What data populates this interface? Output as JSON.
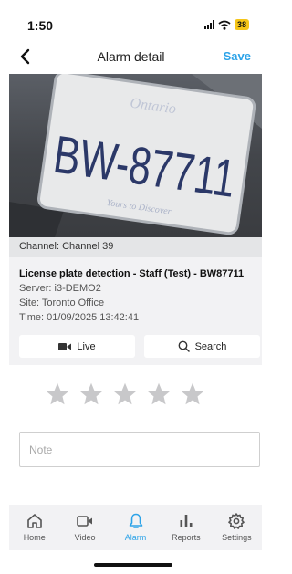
{
  "status_bar": {
    "time": "1:50",
    "battery": "38"
  },
  "header": {
    "title": "Alarm detail",
    "save_label": "Save"
  },
  "photo": {
    "plate_text": "BW-87711",
    "plate_region": "Ontario",
    "plate_tagline": "Yours to Discover"
  },
  "channel": {
    "label": "Channel: Channel 39"
  },
  "alarm": {
    "title": "License plate detection - Staff (Test) - BW87711",
    "server": "Server: i3-DEMO2",
    "site": "Site: Toronto Office",
    "time": "Time: 01/09/2025 13:42:41"
  },
  "actions": {
    "live_label": "Live",
    "search_label": "Search"
  },
  "rating": {
    "value": 0,
    "max": 5
  },
  "note": {
    "placeholder": "Note",
    "value": ""
  },
  "tabs": [
    {
      "label": "Home",
      "icon": "home-icon"
    },
    {
      "label": "Video",
      "icon": "video-camera-icon"
    },
    {
      "label": "Alarm",
      "icon": "bell-icon",
      "active": true
    },
    {
      "label": "Reports",
      "icon": "bar-chart-icon"
    },
    {
      "label": "Settings",
      "icon": "gear-icon"
    }
  ],
  "colors": {
    "accent": "#2ca3e8",
    "star": "#c8c8ca"
  }
}
